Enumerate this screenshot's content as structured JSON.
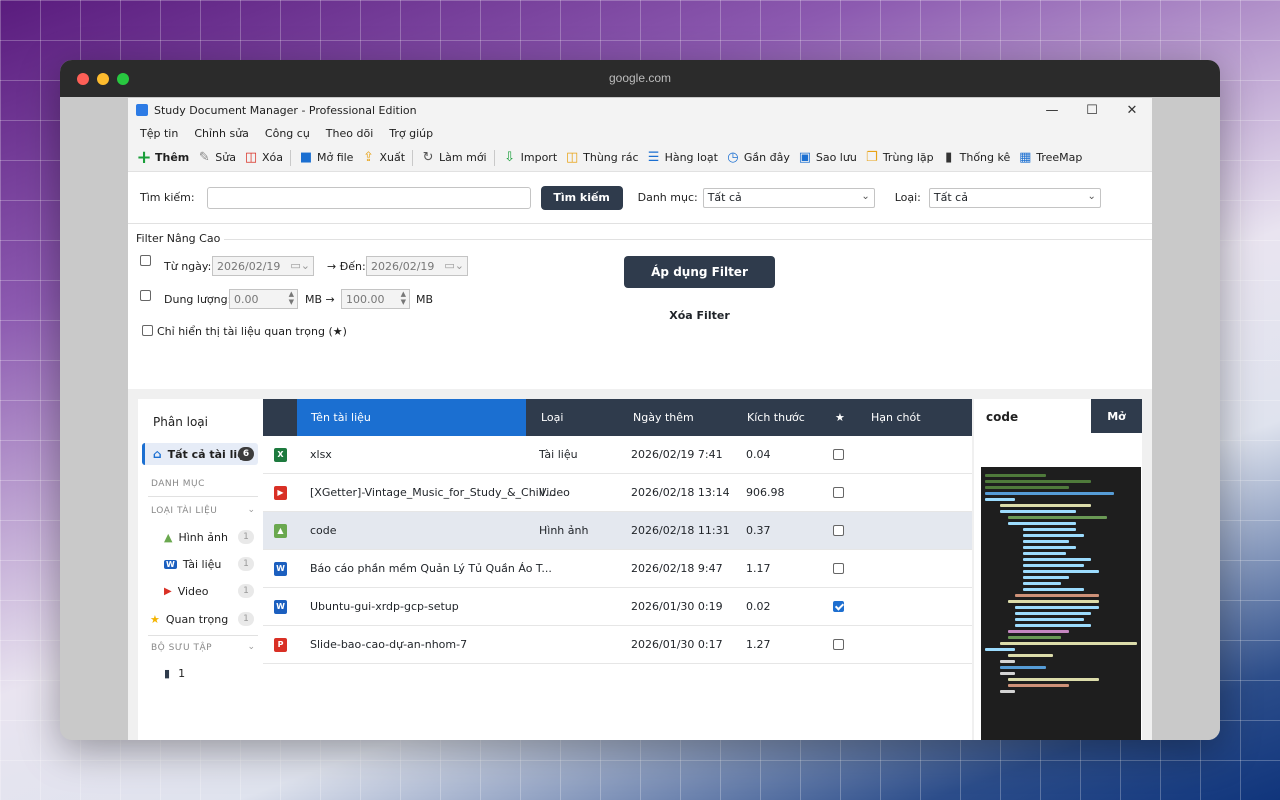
{
  "browser": {
    "url": "google.com"
  },
  "app": {
    "title": "Study Document Manager - Professional Edition",
    "window_controls": [
      "—",
      "☐",
      "✕"
    ]
  },
  "menu": [
    "Tệp tin",
    "Chỉnh sửa",
    "Công cụ",
    "Theo dõi",
    "Trợ giúp"
  ],
  "toolbar": [
    {
      "label": "Thêm",
      "icon": "plus-icon",
      "color": "#1a9e3a",
      "glyph": "+"
    },
    {
      "label": "Sửa",
      "icon": "pencil-icon",
      "color": "#888888",
      "glyph": "✎"
    },
    {
      "label": "Xóa",
      "icon": "trash-icon",
      "color": "#d93025",
      "glyph": "🗑"
    },
    {
      "label": "Mở file",
      "icon": "folder-icon",
      "color": "#1b6fd1",
      "glyph": "■"
    },
    {
      "label": "Xuất",
      "icon": "export-icon",
      "color": "#e8a317",
      "glyph": "⇪"
    },
    {
      "label": "Làm mới",
      "icon": "refresh-icon",
      "color": "#555555",
      "glyph": "↻"
    },
    {
      "label": "Import",
      "icon": "import-icon",
      "color": "#1a9e3a",
      "glyph": "⇩"
    },
    {
      "label": "Thùng rác",
      "icon": "bin-icon",
      "color": "#e8a317",
      "glyph": "🗑"
    },
    {
      "label": "Hàng loạt",
      "icon": "list-icon",
      "color": "#1b6fd1",
      "glyph": "☰"
    },
    {
      "label": "Gần đây",
      "icon": "clock-icon",
      "color": "#1b6fd1",
      "glyph": "◷"
    },
    {
      "label": "Sao lưu",
      "icon": "save-icon",
      "color": "#1b6fd1",
      "glyph": "▣"
    },
    {
      "label": "Trùng lặp",
      "icon": "duplicate-icon",
      "color": "#e8a317",
      "glyph": "❐"
    },
    {
      "label": "Thống kê",
      "icon": "chart-icon",
      "color": "#333333",
      "glyph": "▮"
    },
    {
      "label": "TreeMap",
      "icon": "treemap-icon",
      "color": "#1b6fd1",
      "glyph": "▦"
    }
  ],
  "search": {
    "label": "Tìm kiếm:",
    "value": "",
    "button": "Tìm kiếm",
    "category_label": "Danh mục:",
    "category_value": "Tất cả",
    "type_label": "Loại:",
    "type_value": "Tất cả"
  },
  "filter": {
    "title": "Filter Nâng Cao",
    "from_label": "Từ ngày:",
    "from_value": "2026/02/19",
    "to_label": "→ Đến:",
    "to_value": "2026/02/19",
    "size_label": "Dung lượng:",
    "size_min": "0.00",
    "size_unit_mid": "MB →",
    "size_max": "100.00",
    "size_unit": "MB",
    "important_only": "Chỉ hiển thị tài liệu quan trọng (★)",
    "apply": "Áp dụng Filter",
    "clear": "Xóa Filter"
  },
  "sidebar": {
    "title": "Phân loại",
    "all_label": "Tất cả tài liệu",
    "all_count": "6",
    "section_category": "DANH MỤC",
    "section_type": "LOẠI TÀI LIỆU",
    "types": [
      {
        "label": "Hình ảnh",
        "count": "1",
        "icon": "image-icon"
      },
      {
        "label": "Tài liệu",
        "count": "1",
        "icon": "word-icon"
      },
      {
        "label": "Video",
        "count": "1",
        "icon": "video-icon"
      }
    ],
    "important_label": "Quan trọng",
    "important_count": "1",
    "section_collection": "BỘ SƯU TẬP",
    "collection_item": "1"
  },
  "table": {
    "headers": [
      "Tên tài liệu",
      "Loại",
      "Ngày thêm",
      "Kích thước",
      "★",
      "Hạn chót"
    ],
    "rows": [
      {
        "icon": "excel-icon",
        "icon_color": "#1d7a3e",
        "glyph": "X",
        "name": "xlsx",
        "type": "Tài liệu",
        "date": "2026/02/19 7:41",
        "size": "0.04",
        "star": false
      },
      {
        "icon": "video-file-icon",
        "icon_color": "#d93025",
        "glyph": "▶",
        "name": "[XGetter]-Vintage_Music_for_Study_&_Chill...",
        "type": "Video",
        "date": "2026/02/18 13:14",
        "size": "906.98",
        "star": false
      },
      {
        "icon": "image-file-icon",
        "icon_color": "#6aa84f",
        "glyph": "▲",
        "name": "code",
        "type": "Hình ảnh",
        "date": "2026/02/18 11:31",
        "size": "0.37",
        "star": false
      },
      {
        "icon": "word-file-icon",
        "icon_color": "#1b5fbf",
        "glyph": "W",
        "name": "Báo cáo phần mềm Quản Lý Tủ Quần Áo T...",
        "type": "",
        "date": "2026/02/18 9:47",
        "size": "1.17",
        "star": false
      },
      {
        "icon": "word-file-icon",
        "icon_color": "#1b5fbf",
        "glyph": "W",
        "name": "Ubuntu-gui-xrdp-gcp-setup",
        "type": "",
        "date": "2026/01/30 0:19",
        "size": "0.02",
        "star": true
      },
      {
        "icon": "pdf-file-icon",
        "icon_color": "#d93025",
        "glyph": "P",
        "name": "Slide-bao-cao-dự-an-nhom-7",
        "type": "",
        "date": "2026/01/30 0:17",
        "size": "1.27",
        "star": false
      }
    ]
  },
  "preview": {
    "title": "code",
    "open_button": "Mở"
  }
}
